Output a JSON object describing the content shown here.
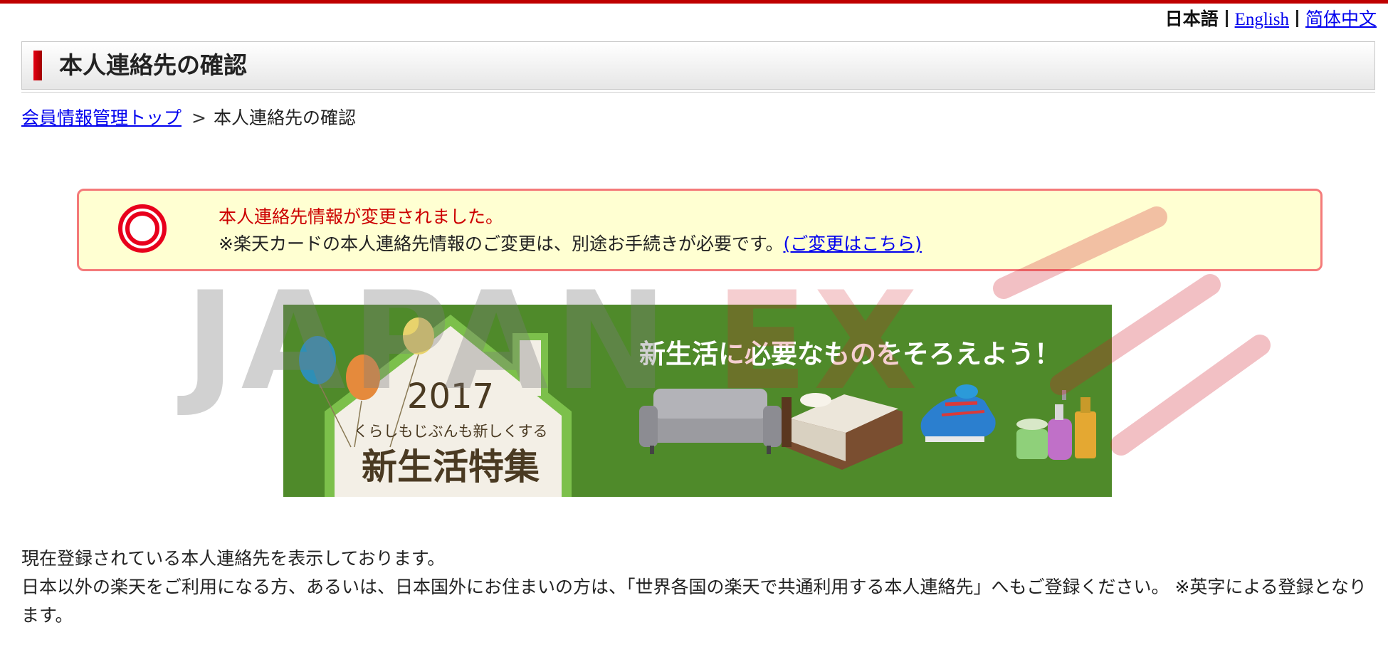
{
  "language_switch": {
    "current": "日本語",
    "english": "English",
    "chinese": "简体中文"
  },
  "header": {
    "title": "本人連絡先の確認"
  },
  "breadcrumb": {
    "parent": "会員情報管理トップ",
    "separator": ">",
    "current": "本人連絡先の確認"
  },
  "notice": {
    "success_message": "本人連絡先情報が変更されました。",
    "card_note": "※楽天カードの本人連絡先情報のご変更は、別途お手続きが必要です。",
    "card_link": "(ご変更はこちら)"
  },
  "banner": {
    "headline": "新生活に必要なものをそろえよう！",
    "year": "2017",
    "subtitle": "くらしもじぶんも新しくする",
    "title": "新生活特集",
    "colors": {
      "background": "#4f8a2a",
      "house": "#f3efe6",
      "outline": "#7cc04b"
    }
  },
  "intro": {
    "line1": "現在登録されている本人連絡先を表示しております。",
    "line2": "日本以外の楽天をご利用になる方、あるいは、日本国外にお住まいの方は、「世界各国の楽天で共通利用する本人連絡先」へもご登録ください。 ※英字による登録となります。"
  },
  "watermark": {
    "text_gray": "JAPAN",
    "text_red": "EX"
  }
}
